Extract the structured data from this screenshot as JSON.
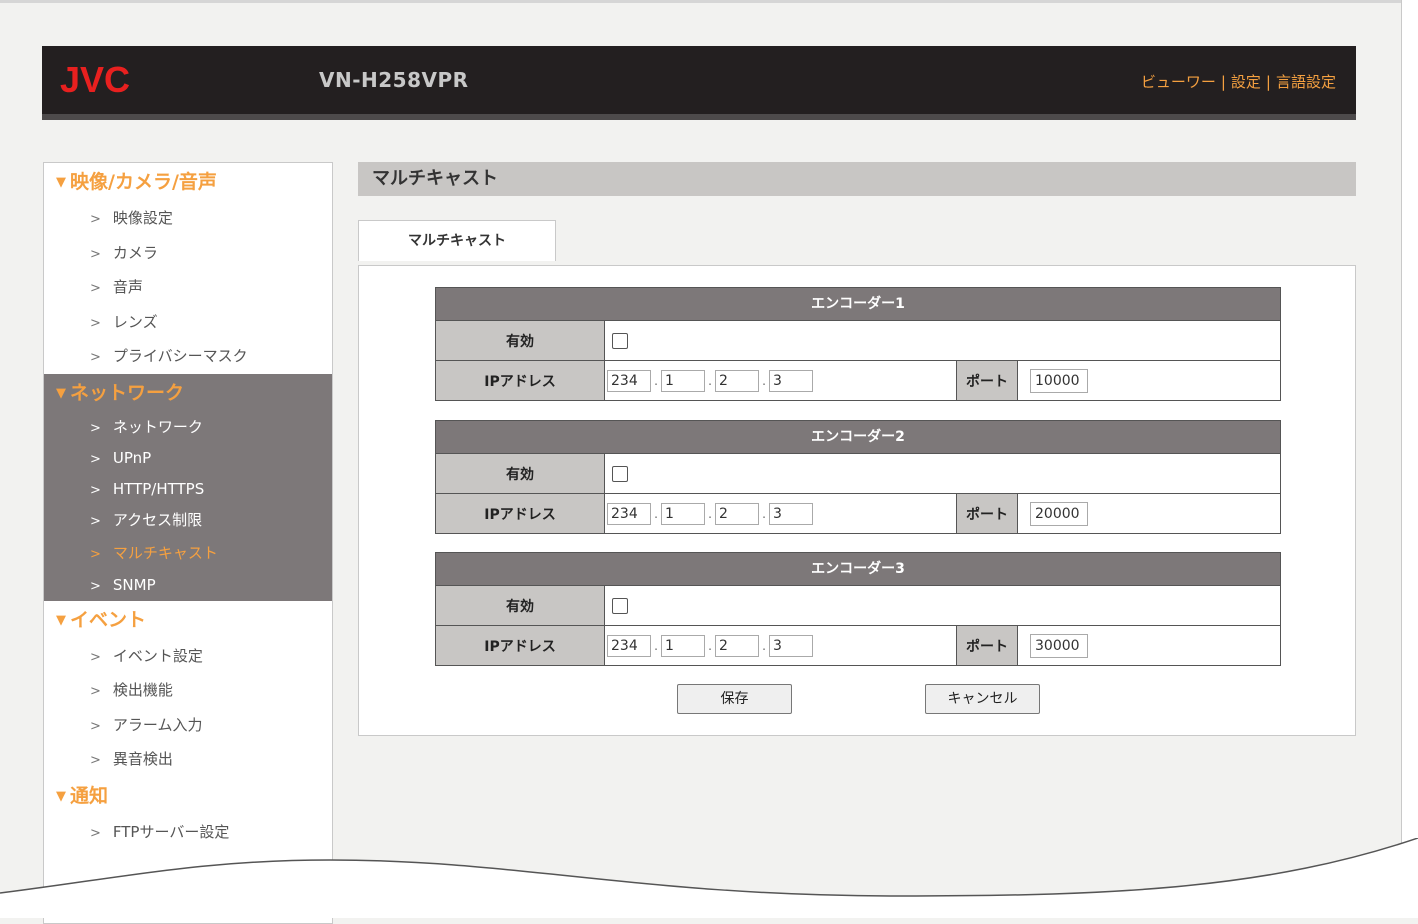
{
  "header": {
    "brand": "JVC",
    "model": "VN-H258VPR",
    "links": [
      "ビューワー",
      "設定",
      "言語設定"
    ],
    "separator": "|"
  },
  "sidebar": {
    "groups": [
      {
        "title": "映像/カメラ/音声",
        "items": [
          "映像設定",
          "カメラ",
          "音声",
          "レンズ",
          "プライバシーマスク"
        ]
      },
      {
        "title": "ネットワーク",
        "items": [
          "ネットワーク",
          "UPnP",
          "HTTP/HTTPS",
          "アクセス制限",
          "マルチキャスト",
          "SNMP"
        ],
        "selected": "マルチキャスト"
      },
      {
        "title": "イベント",
        "items": [
          "イベント設定",
          "検出機能",
          "アラーム入力",
          "異音検出"
        ]
      },
      {
        "title": "通知",
        "items": [
          "FTPサーバー設定"
        ]
      }
    ]
  },
  "main": {
    "title": "マルチキャスト",
    "tab": "マルチキャスト",
    "labels": {
      "enabled": "有効",
      "ip": "IPアドレス",
      "port": "ポート"
    },
    "encoders": [
      {
        "name": "エンコーダー1",
        "enabled": false,
        "ip": [
          "234",
          "1",
          "2",
          "3"
        ],
        "port": "10000"
      },
      {
        "name": "エンコーダー2",
        "enabled": false,
        "ip": [
          "234",
          "1",
          "2",
          "3"
        ],
        "port": "20000"
      },
      {
        "name": "エンコーダー3",
        "enabled": false,
        "ip": [
          "234",
          "1",
          "2",
          "3"
        ],
        "port": "30000"
      }
    ],
    "buttons": {
      "save": "保存",
      "cancel": "キャンセル"
    }
  },
  "icons": {
    "group_toggle": "triangle-down-icon",
    "nav_chevron": "chevron-right-icon"
  },
  "colors": {
    "accent": "#f5a040",
    "header_bg": "#231f20",
    "brand_red": "#e8201f",
    "active_group_bg": "#7d7879",
    "label_bg": "#c8c6c4"
  }
}
